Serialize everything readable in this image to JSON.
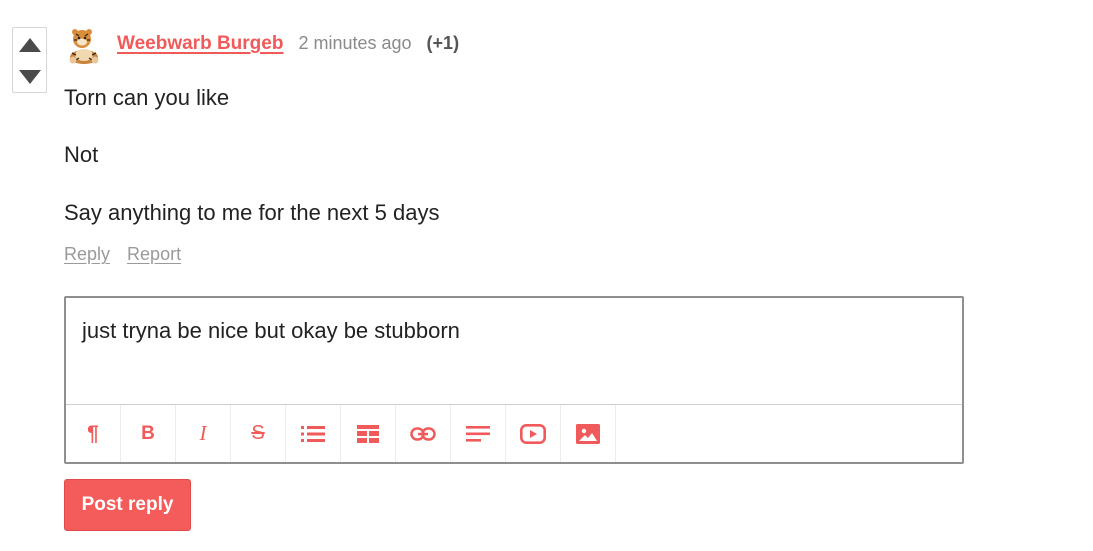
{
  "comment": {
    "author": "Weebwarb Burgeb",
    "time": "2 minutes ago",
    "score": "(+1)",
    "paragraphs": [
      "Torn can you like",
      "Not",
      "Say anything to me for the next 5 days"
    ],
    "actions": {
      "reply": "Reply",
      "report": "Report"
    }
  },
  "votes": {
    "up_icon": "triangle-up-icon",
    "down_icon": "triangle-down-icon"
  },
  "editor": {
    "value": "just tryna be nice but okay be stubborn",
    "toolbar": [
      {
        "name": "paragraph-icon",
        "glyph": "¶"
      },
      {
        "name": "bold-icon",
        "glyph": "B"
      },
      {
        "name": "italic-icon",
        "glyph": "I"
      },
      {
        "name": "strikethrough-icon",
        "glyph": "S"
      },
      {
        "name": "bullet-list-icon",
        "glyph": ""
      },
      {
        "name": "table-icon",
        "glyph": ""
      },
      {
        "name": "link-icon",
        "glyph": ""
      },
      {
        "name": "align-left-icon",
        "glyph": ""
      },
      {
        "name": "youtube-icon",
        "glyph": ""
      },
      {
        "name": "image-icon",
        "glyph": ""
      }
    ]
  },
  "post_button": {
    "label": "Post reply"
  },
  "colors": {
    "accent": "#f05a5a",
    "button": "#f45b5b",
    "muted": "#8a8a8a"
  }
}
